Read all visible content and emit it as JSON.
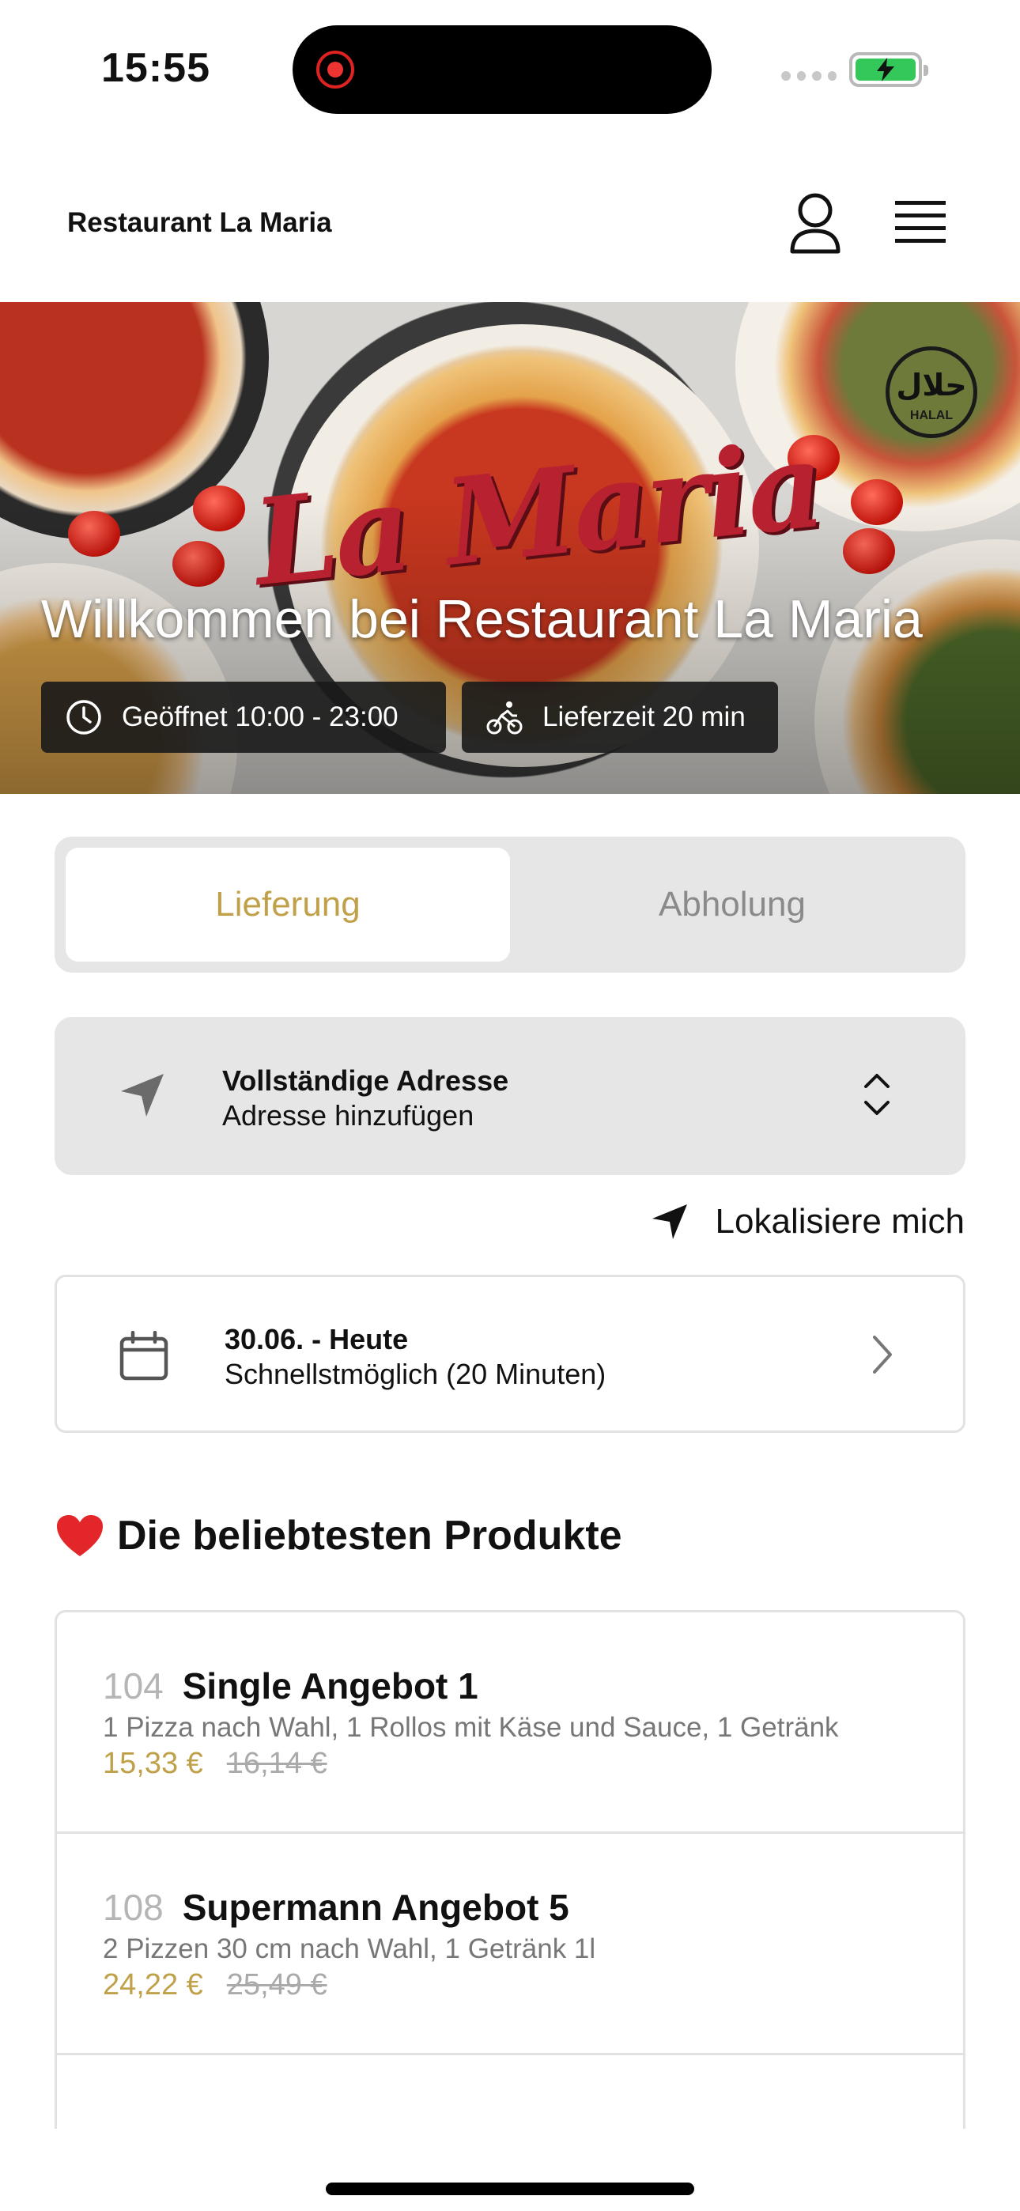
{
  "status_bar": {
    "time": "15:55"
  },
  "header": {
    "title": "Restaurant La Maria"
  },
  "hero": {
    "logo_text": "La Maria",
    "badge_text": "HALAL",
    "badge_arabic": "حلال",
    "welcome": "Willkommen bei Restaurant La Maria",
    "hours": "Geöffnet 10:00 - 23:00",
    "delivery_time": "Lieferzeit 20 min"
  },
  "mode_tabs": [
    {
      "label": "Lieferung",
      "active": true
    },
    {
      "label": "Abholung",
      "active": false
    }
  ],
  "address": {
    "title": "Vollständige Adresse",
    "subtitle": "Adresse hinzufügen"
  },
  "locate_me": "Lokalisiere mich",
  "schedule": {
    "date": "30.06. - Heute",
    "time": "Schnellstmöglich (20 Minuten)"
  },
  "popular": {
    "title": "Die beliebtesten Produkte",
    "products": [
      {
        "number": "104",
        "name": "Single Angebot 1",
        "description": "1 Pizza nach Wahl, 1 Rollos mit Käse und Sauce, 1 Getränk",
        "price": "15,33 €",
        "old_price": "16,14 €"
      },
      {
        "number": "108",
        "name": "Supermann Angebot 5",
        "description": "2 Pizzen 30 cm nach Wahl, 1 Getränk 1l",
        "price": "24,22 €",
        "old_price": "25,49 €"
      }
    ]
  },
  "colors": {
    "accent": "#c0a14a",
    "card_bg": "#e6e6e6"
  }
}
